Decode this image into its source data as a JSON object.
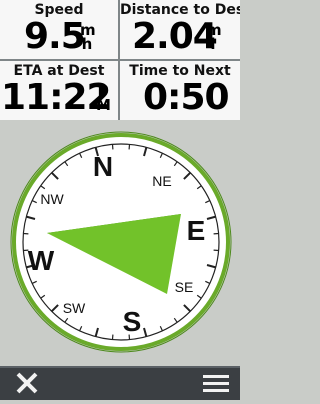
{
  "fields": [
    {
      "label": "Speed",
      "value": "9.5",
      "unit_top": "m",
      "unit_bottom": "h"
    },
    {
      "label": "Distance to Dest.",
      "value": "2.04",
      "unit_top": "m",
      "unit_bottom": "i"
    },
    {
      "label": "ETA at Dest",
      "value": "11:22",
      "unit_top": "P",
      "unit_bottom": "M"
    },
    {
      "label": "Time to Next",
      "value": "0:50"
    }
  ],
  "compass": {
    "cardinals": {
      "n": "N",
      "e": "E",
      "s": "S",
      "w": "W"
    },
    "intercardinals": {
      "ne": "NE",
      "se": "SE",
      "sw": "SW",
      "nw": "NW"
    },
    "bearing_pointer_color": "#72c22a",
    "ring_color": "#6aaa2a"
  },
  "toolbar": {
    "close_icon": "close-icon",
    "menu_icon": "menu-icon"
  }
}
